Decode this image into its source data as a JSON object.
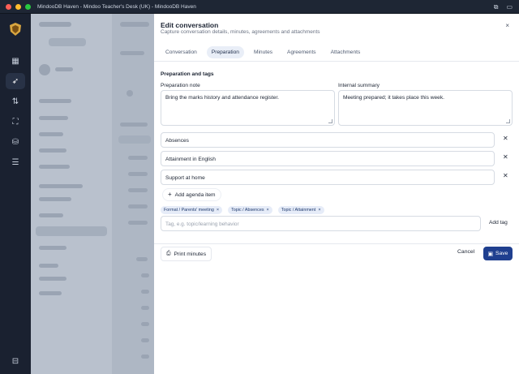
{
  "window": {
    "title": "MindooDB Haven - Mindoo Teacher's Desk (UK) - MindooDB Haven",
    "traffic_colors": [
      "#ff5f57",
      "#febc2e",
      "#28c840"
    ]
  },
  "rail": {
    "items": [
      {
        "name": "grid-icon",
        "glyph": "▦"
      },
      {
        "name": "rocket-icon",
        "glyph": "➶",
        "active": true
      },
      {
        "name": "sort-icon",
        "glyph": "⇅"
      },
      {
        "name": "scan-icon",
        "glyph": "⛶"
      },
      {
        "name": "database-icon",
        "glyph": "⛁"
      },
      {
        "name": "sliders-icon",
        "glyph": "☰"
      }
    ],
    "bottom_icon": "⊟"
  },
  "drawer": {
    "title": "Edit conversation",
    "subtitle": "Capture conversation details, minutes, agreements and attachments",
    "close_glyph": "×",
    "tabs": [
      {
        "label": "Conversation",
        "active": false
      },
      {
        "label": "Preparation",
        "active": true
      },
      {
        "label": "Minutes",
        "active": false
      },
      {
        "label": "Agreements",
        "active": false
      },
      {
        "label": "Attachments",
        "active": false
      }
    ],
    "section_title": "Preparation and tags",
    "preparation_note": {
      "label": "Preparation note",
      "value": "Bring the marks history and attendance register."
    },
    "internal_summary": {
      "label": "Internal summary",
      "value": "Meeting prepared; it takes place this week."
    },
    "agenda_items": [
      "Absences",
      "Attainment in English",
      "Support at home"
    ],
    "add_agenda_label": "Add agenda item",
    "tags": [
      "Format / Parents' meeting",
      "Topic / Absences",
      "Topic / Attainment"
    ],
    "tag_placeholder": "Tag, e.g. topic/learning behavior",
    "add_tag_label": "Add tag",
    "print_label": "Print minutes",
    "cancel_label": "Cancel",
    "save_label": "Save",
    "accent_color": "#1f3f8f"
  }
}
